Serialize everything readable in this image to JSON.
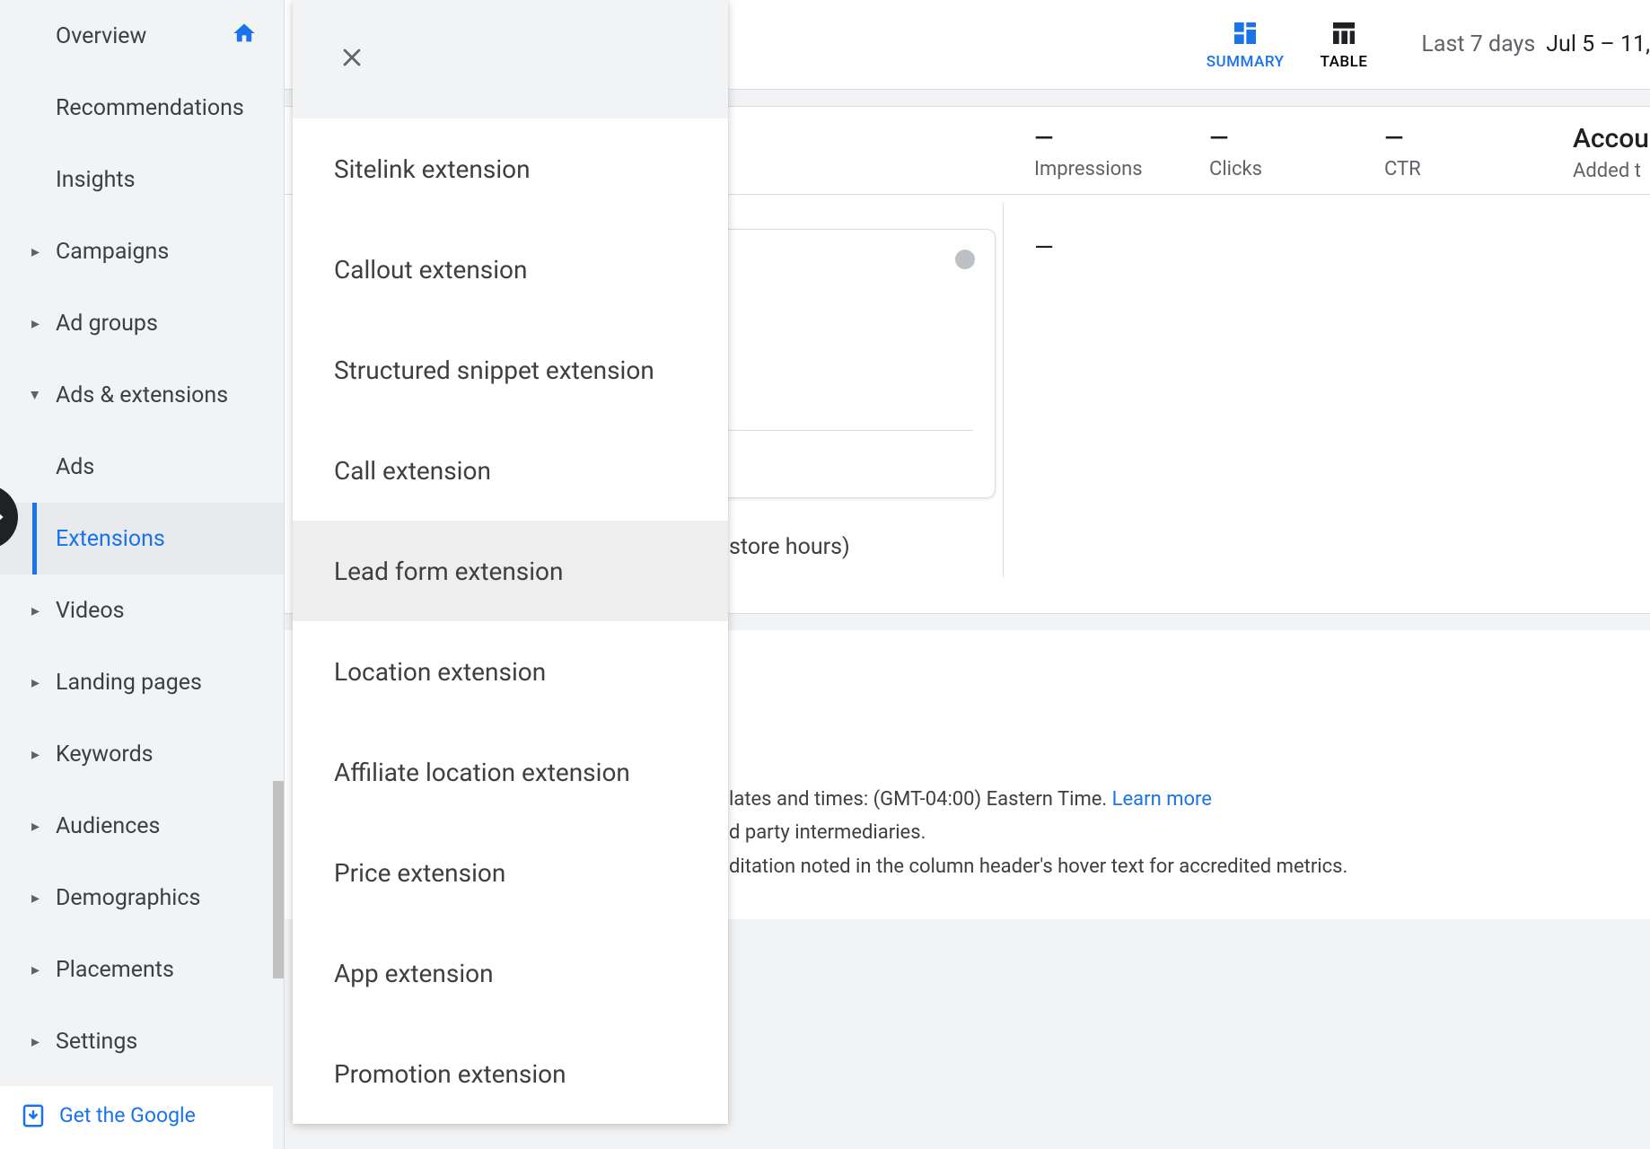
{
  "sidebar": {
    "items": [
      {
        "label": "Overview"
      },
      {
        "label": "Recommendations"
      },
      {
        "label": "Insights"
      },
      {
        "label": "Campaigns"
      },
      {
        "label": "Ad groups"
      },
      {
        "label": "Ads & extensions"
      },
      {
        "label": "Videos"
      },
      {
        "label": "Landing pages"
      },
      {
        "label": "Keywords"
      },
      {
        "label": "Audiences"
      },
      {
        "label": "Demographics"
      },
      {
        "label": "Placements"
      },
      {
        "label": "Settings"
      }
    ],
    "sub_ads": "Ads",
    "sub_extensions": "Extensions",
    "promo": "Get the Google"
  },
  "topbar": {
    "summary": "SUMMARY",
    "table": "TABLE",
    "range_label": "Last 7 days",
    "range_value": "Jul 5 – 11,"
  },
  "stats": {
    "impressions": {
      "value": "—",
      "label": "Impressions"
    },
    "clicks": {
      "value": "—",
      "label": "Clicks"
    },
    "ctr": {
      "value": "—",
      "label": "CTR"
    },
    "account_title": "Accou",
    "account_sub": "Added t"
  },
  "card_dash": "—",
  "hours_fragment": "store hours)",
  "footer": {
    "l1a": "lates and times: (GMT-04:00) Eastern Time. ",
    "l1b": "Learn more",
    "l2": "d party intermediaries.",
    "l3": "ditation noted in the column header's hover text for accredited metrics."
  },
  "dropdown": {
    "items": [
      "Sitelink extension",
      "Callout extension",
      "Structured snippet extension",
      "Call extension",
      "Lead form extension",
      "Location extension",
      "Affiliate location extension",
      "Price extension",
      "App extension",
      "Promotion extension"
    ]
  }
}
